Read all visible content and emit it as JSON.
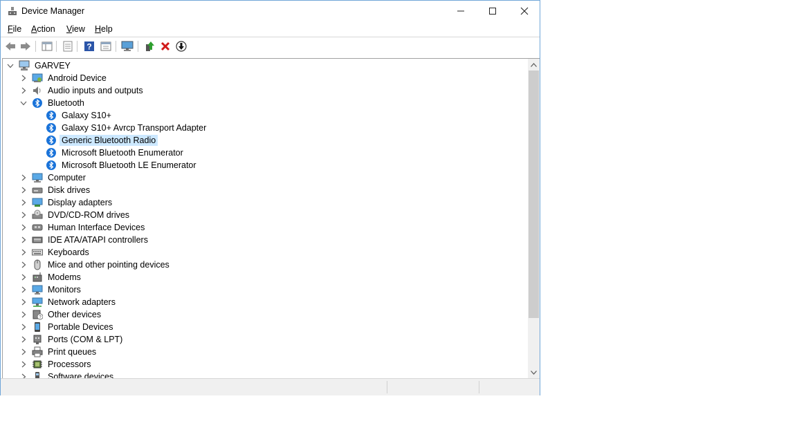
{
  "window": {
    "title": "Device Manager"
  },
  "menu": [
    "File",
    "Action",
    "View",
    "Help"
  ],
  "toolbar": {
    "icons": [
      "back-arrow-icon",
      "forward-arrow-icon",
      "show-hide-tree-icon",
      "properties-icon",
      "help-icon",
      "view-icon",
      "scan-hardware-icon",
      "update-driver-icon",
      "uninstall-icon",
      "disable-device-icon"
    ]
  },
  "tree": {
    "root": "GARVEY",
    "categories": [
      {
        "label": "Android Device",
        "icon": "android-device-icon",
        "expanded": false
      },
      {
        "label": "Audio inputs and outputs",
        "icon": "speaker-icon",
        "expanded": false
      },
      {
        "label": "Bluetooth",
        "icon": "bluetooth-icon",
        "expanded": true,
        "children": [
          "Galaxy S10+",
          "Galaxy S10+ Avrcp Transport Adapter",
          "Generic Bluetooth Radio",
          "Microsoft Bluetooth Enumerator",
          "Microsoft Bluetooth LE Enumerator"
        ],
        "selected_child": 2
      },
      {
        "label": "Computer",
        "icon": "computer-icon",
        "expanded": false
      },
      {
        "label": "Disk drives",
        "icon": "disk-drive-icon",
        "expanded": false
      },
      {
        "label": "Display adapters",
        "icon": "display-adapter-icon",
        "expanded": false
      },
      {
        "label": "DVD/CD-ROM drives",
        "icon": "dvd-drive-icon",
        "expanded": false
      },
      {
        "label": "Human Interface Devices",
        "icon": "hid-icon",
        "expanded": false
      },
      {
        "label": "IDE ATA/ATAPI controllers",
        "icon": "ide-controller-icon",
        "expanded": false
      },
      {
        "label": "Keyboards",
        "icon": "keyboard-icon",
        "expanded": false
      },
      {
        "label": "Mice and other pointing devices",
        "icon": "mouse-icon",
        "expanded": false
      },
      {
        "label": "Modems",
        "icon": "modem-icon",
        "expanded": false
      },
      {
        "label": "Monitors",
        "icon": "monitor-icon",
        "expanded": false
      },
      {
        "label": "Network adapters",
        "icon": "network-adapter-icon",
        "expanded": false
      },
      {
        "label": "Other devices",
        "icon": "other-devices-icon",
        "expanded": false
      },
      {
        "label": "Portable Devices",
        "icon": "portable-device-icon",
        "expanded": false
      },
      {
        "label": "Ports (COM & LPT)",
        "icon": "port-icon",
        "expanded": false
      },
      {
        "label": "Print queues",
        "icon": "printer-icon",
        "expanded": false
      },
      {
        "label": "Processors",
        "icon": "processor-icon",
        "expanded": false
      },
      {
        "label": "Software devices",
        "icon": "software-device-icon",
        "expanded": false
      }
    ]
  },
  "colors": {
    "selection": "#cce8ff",
    "bluetooth": "#1a73d9",
    "uninstall": "#d11a1a",
    "window_border": "#6fa6d8"
  }
}
